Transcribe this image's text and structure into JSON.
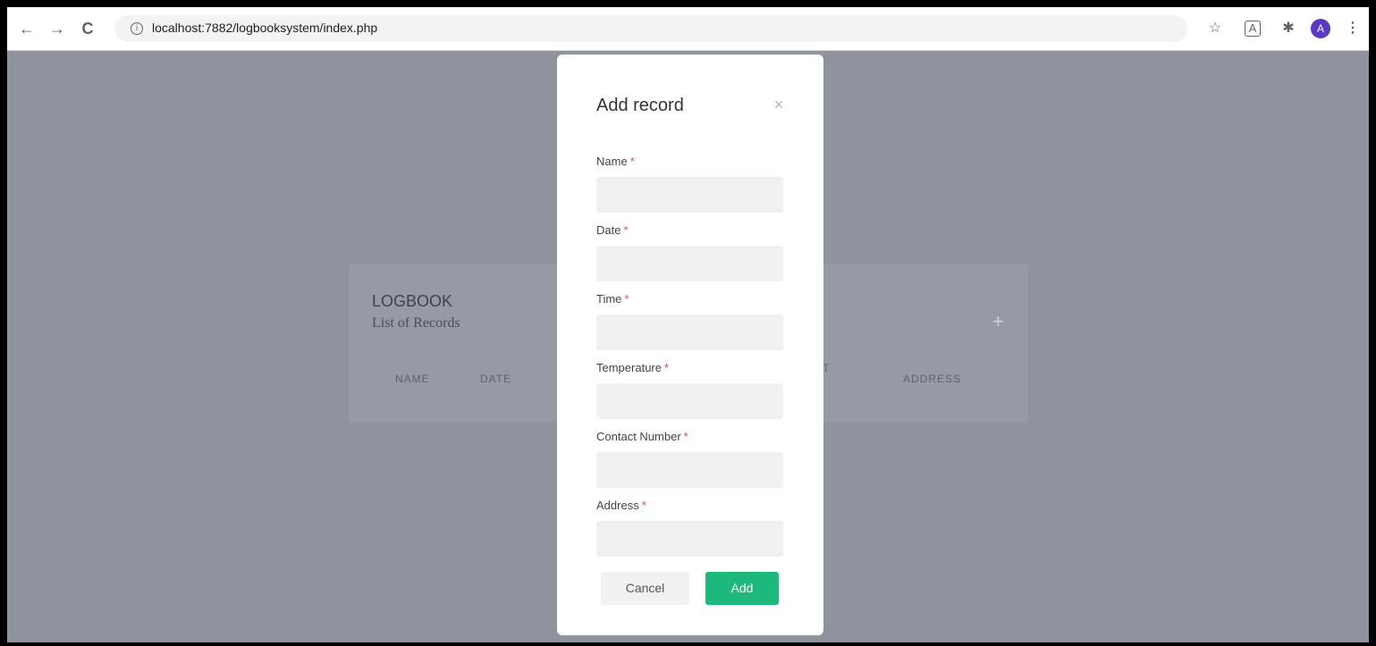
{
  "browser": {
    "url": "localhost:7882/logbooksystem/index.php",
    "back_icon": "←",
    "forward_icon": "→",
    "reload_icon": "C",
    "info_icon": "i",
    "star_icon": "☆",
    "ext1_icon": "A",
    "puzzle_icon": "✱",
    "avatar_letter": "A",
    "menu_icon": "⋮"
  },
  "background": {
    "title": "LOGBOOK",
    "subtitle": "List of Records",
    "plus_icon": "+",
    "columns": [
      "NAME",
      "DATE",
      "T",
      "ADDRESS"
    ]
  },
  "modal": {
    "title": "Add record",
    "close_icon": "×",
    "required_mark": "*",
    "fields": [
      {
        "label": "Name",
        "value": ""
      },
      {
        "label": "Date",
        "value": ""
      },
      {
        "label": "Time",
        "value": ""
      },
      {
        "label": "Temperature",
        "value": ""
      },
      {
        "label": "Contact Number",
        "value": ""
      },
      {
        "label": "Address",
        "value": ""
      }
    ],
    "cancel_label": "Cancel",
    "add_label": "Add"
  },
  "colors": {
    "overlay": "#8f939e",
    "accent_green": "#1cb87c",
    "required_red": "#e24c4c",
    "avatar_purple": "#5a39c6"
  }
}
